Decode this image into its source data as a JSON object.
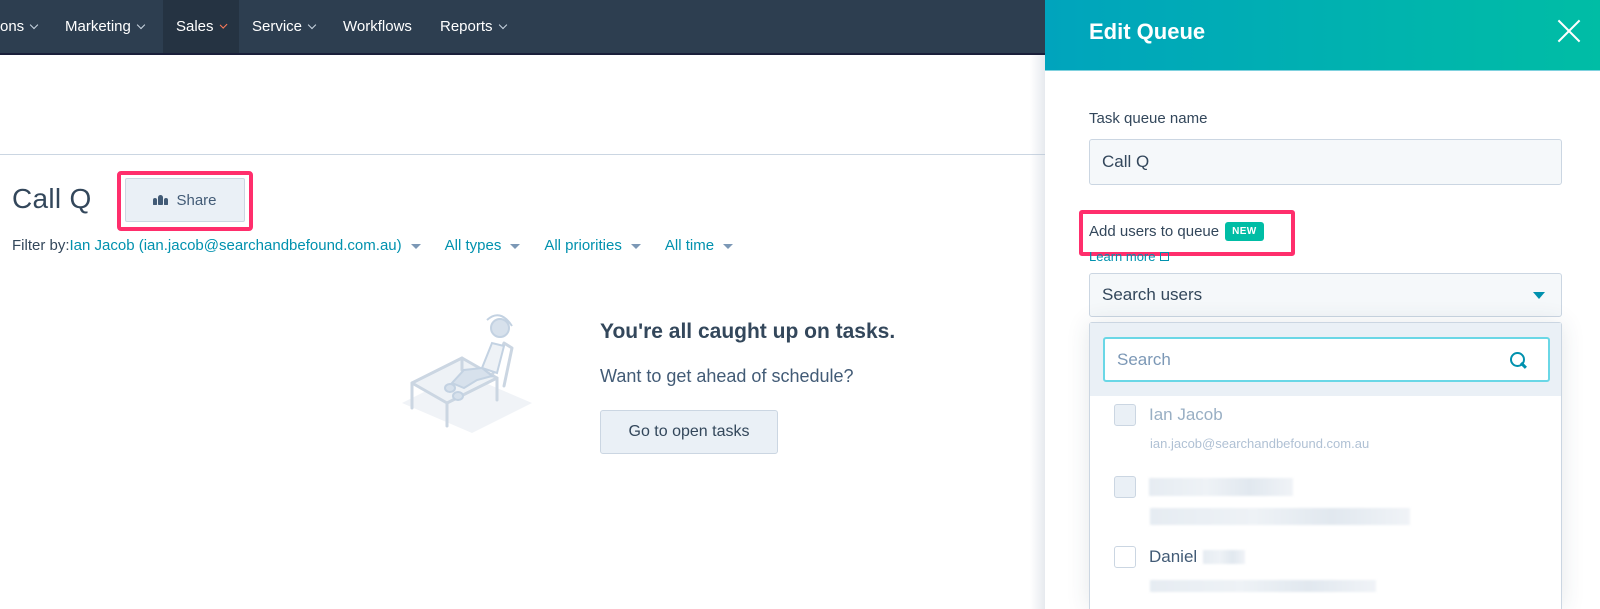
{
  "topnav": {
    "items": [
      {
        "label": "ons",
        "has_dropdown": true,
        "active": false
      },
      {
        "label": "Marketing",
        "has_dropdown": true,
        "active": false
      },
      {
        "label": "Sales",
        "has_dropdown": true,
        "active": true
      },
      {
        "label": "Service",
        "has_dropdown": true,
        "active": false
      },
      {
        "label": "Workflows",
        "has_dropdown": false,
        "active": false
      },
      {
        "label": "Reports",
        "has_dropdown": true,
        "active": false
      }
    ]
  },
  "page": {
    "title": "Call Q",
    "share_label": "Share",
    "filter": {
      "label": "Filter by:",
      "owner": "Ian Jacob (ian.jacob@searchandbefound.com.au)",
      "types": "All types",
      "priorities": "All priorities",
      "time": "All time"
    },
    "empty_state": {
      "title": "You're all caught up on tasks.",
      "subtitle": "Want to get ahead of schedule?",
      "button_label": "Go to open tasks"
    }
  },
  "panel": {
    "title": "Edit Queue",
    "queue_name_label": "Task queue name",
    "queue_name_value": "Call Q",
    "add_users_label": "Add users to queue",
    "new_badge": "NEW",
    "learn_more": "Learn more",
    "users_select_placeholder": "Search users",
    "search_placeholder": "Search",
    "users": [
      {
        "name": "Ian Jacob",
        "email": "ian.jacob@searchandbefound.com.au",
        "disabled": true
      },
      {
        "name": "",
        "email": "",
        "disabled": true,
        "redacted": true
      },
      {
        "name": "Daniel",
        "email": "",
        "disabled": false,
        "redacted": true
      }
    ]
  },
  "colors": {
    "nav_bg": "#2d3e50",
    "accent_link": "#0091ae",
    "header_gradient_start": "#00a4bd",
    "header_gradient_end": "#00bda5",
    "highlight": "#ff2e6c",
    "badge": "#00bda5"
  }
}
